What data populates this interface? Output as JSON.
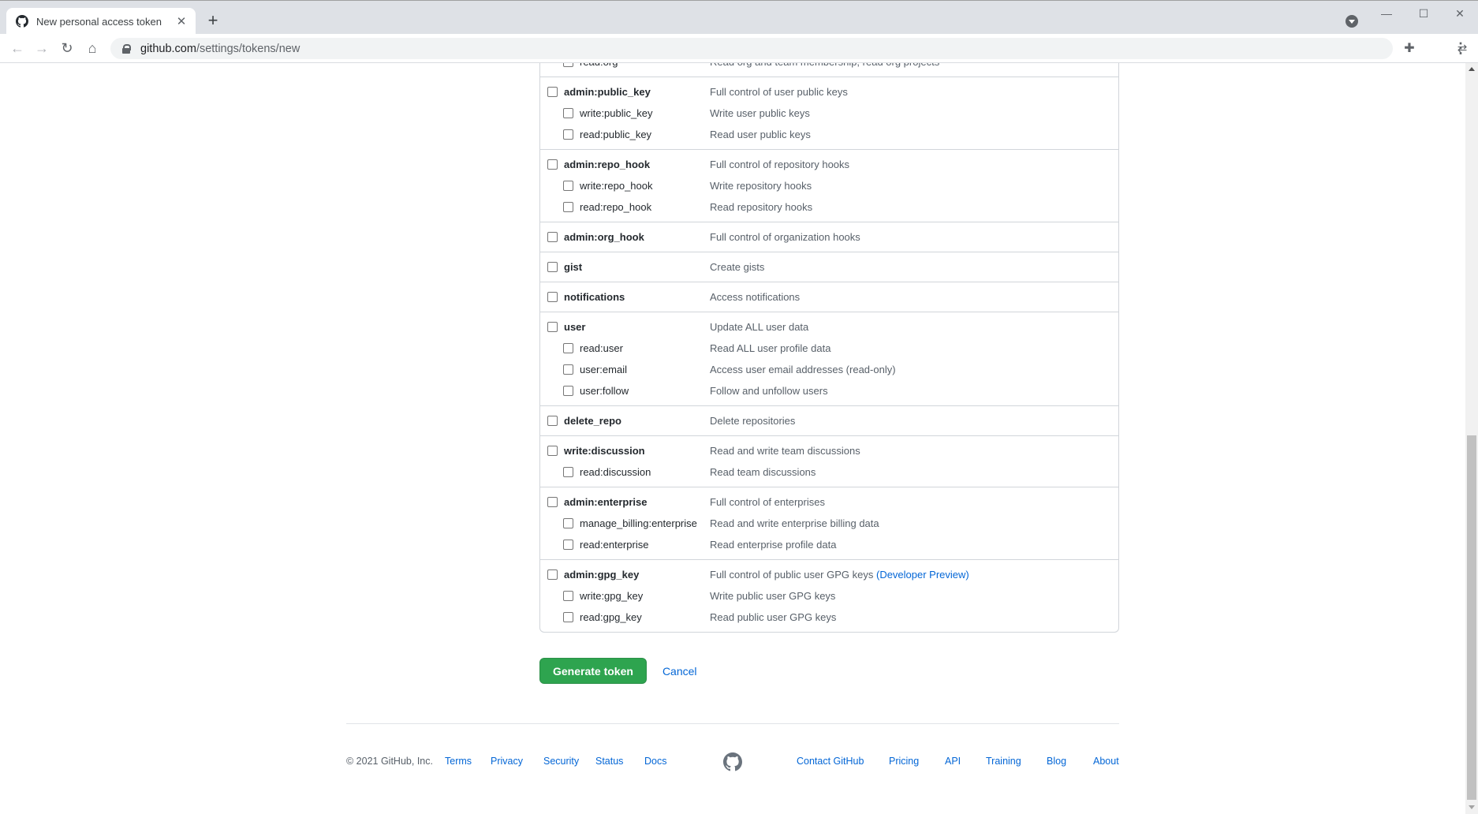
{
  "browser": {
    "tab_title": "New personal access token",
    "new_tab_label": "+",
    "url_host": "github.com",
    "url_path": "/settings/tokens/new"
  },
  "scopes": [
    {
      "rows": [
        {
          "level": "child",
          "name": "read:org",
          "desc": "Read org and team membership, read org projects",
          "checked": false
        }
      ]
    },
    {
      "rows": [
        {
          "level": "parent",
          "name": "admin:public_key",
          "desc": "Full control of user public keys",
          "checked": false
        },
        {
          "level": "child",
          "name": "write:public_key",
          "desc": "Write user public keys",
          "checked": false
        },
        {
          "level": "child",
          "name": "read:public_key",
          "desc": "Read user public keys",
          "checked": false
        }
      ]
    },
    {
      "rows": [
        {
          "level": "parent",
          "name": "admin:repo_hook",
          "desc": "Full control of repository hooks",
          "checked": false
        },
        {
          "level": "child",
          "name": "write:repo_hook",
          "desc": "Write repository hooks",
          "checked": false
        },
        {
          "level": "child",
          "name": "read:repo_hook",
          "desc": "Read repository hooks",
          "checked": false
        }
      ]
    },
    {
      "rows": [
        {
          "level": "parent",
          "name": "admin:org_hook",
          "desc": "Full control of organization hooks",
          "checked": false
        }
      ]
    },
    {
      "rows": [
        {
          "level": "parent",
          "name": "gist",
          "desc": "Create gists",
          "checked": false
        }
      ]
    },
    {
      "rows": [
        {
          "level": "parent",
          "name": "notifications",
          "desc": "Access notifications",
          "checked": false
        }
      ]
    },
    {
      "rows": [
        {
          "level": "parent",
          "name": "user",
          "desc": "Update ALL user data",
          "checked": false
        },
        {
          "level": "child",
          "name": "read:user",
          "desc": "Read ALL user profile data",
          "checked": false
        },
        {
          "level": "child",
          "name": "user:email",
          "desc": "Access user email addresses (read-only)",
          "checked": false
        },
        {
          "level": "child",
          "name": "user:follow",
          "desc": "Follow and unfollow users",
          "checked": false
        }
      ]
    },
    {
      "rows": [
        {
          "level": "parent",
          "name": "delete_repo",
          "desc": "Delete repositories",
          "checked": false
        }
      ]
    },
    {
      "rows": [
        {
          "level": "parent",
          "name": "write:discussion",
          "desc": "Read and write team discussions",
          "checked": false
        },
        {
          "level": "child",
          "name": "read:discussion",
          "desc": "Read team discussions",
          "checked": false
        }
      ]
    },
    {
      "rows": [
        {
          "level": "parent",
          "name": "admin:enterprise",
          "desc": "Full control of enterprises",
          "checked": false
        },
        {
          "level": "child",
          "name": "manage_billing:enterprise",
          "desc": "Read and write enterprise billing data",
          "checked": false
        },
        {
          "level": "child",
          "name": "read:enterprise",
          "desc": "Read enterprise profile data",
          "checked": false
        }
      ]
    },
    {
      "rows": [
        {
          "level": "parent",
          "name": "admin:gpg_key",
          "desc": "Full control of public user GPG keys",
          "link": "(Developer Preview)",
          "checked": false
        },
        {
          "level": "child",
          "name": "write:gpg_key",
          "desc": "Write public user GPG keys",
          "checked": false
        },
        {
          "level": "child",
          "name": "read:gpg_key",
          "desc": "Read public user GPG keys",
          "checked": false
        }
      ]
    }
  ],
  "actions": {
    "generate_label": "Generate token",
    "cancel_label": "Cancel"
  },
  "footer": {
    "copyright": "© 2021 GitHub, Inc.",
    "left_links": [
      "Terms",
      "Privacy",
      "Security",
      "Status",
      "Docs"
    ],
    "right_links": [
      "Contact GitHub",
      "Pricing",
      "API",
      "Training",
      "Blog",
      "About"
    ]
  },
  "colors": {
    "primary_button": "#2ea44f",
    "link": "#0366d6",
    "border": "#d1d5da"
  }
}
